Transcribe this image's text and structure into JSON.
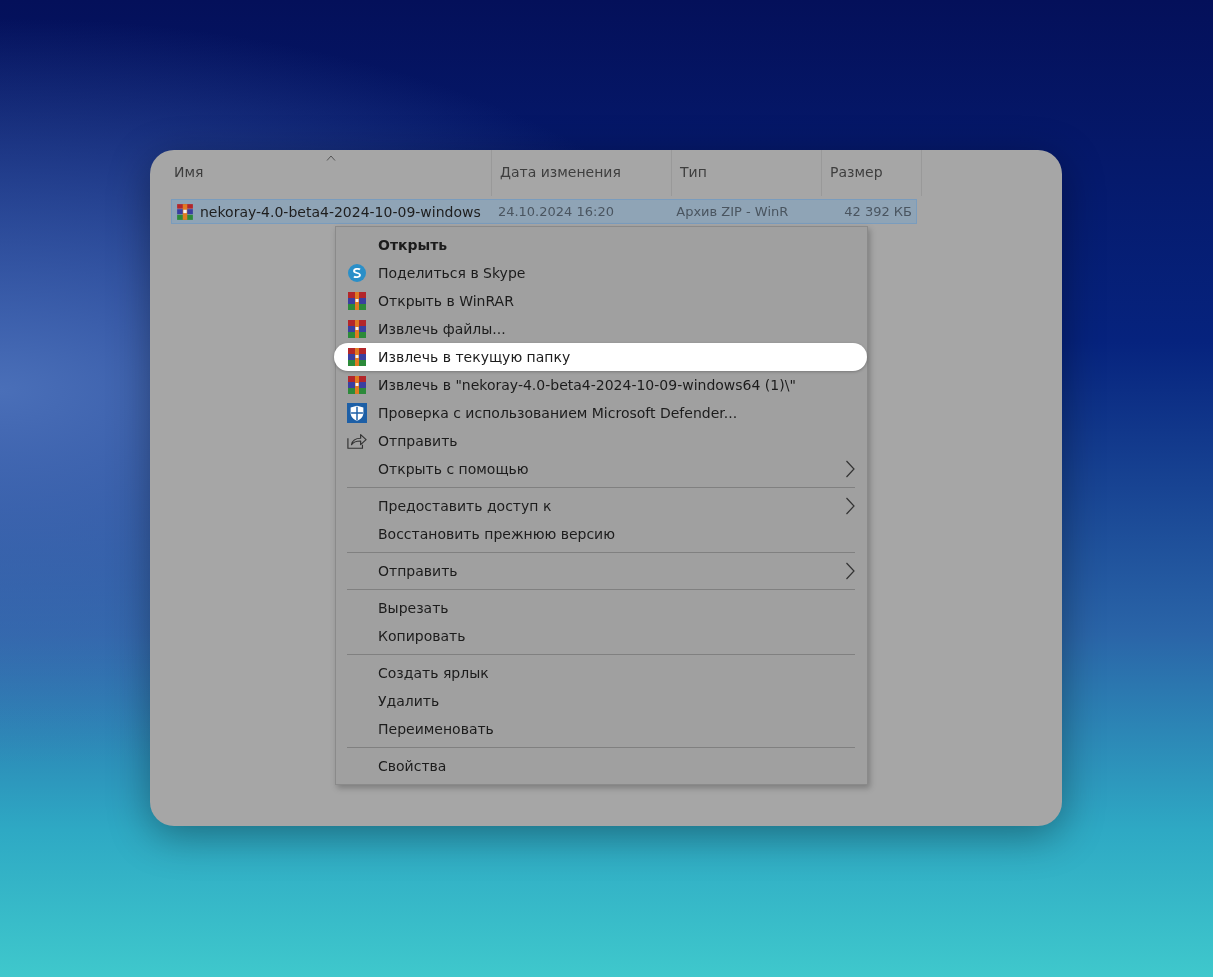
{
  "columns": [
    {
      "label": "Имя",
      "sorted": true
    },
    {
      "label": "Дата изменения",
      "sorted": false
    },
    {
      "label": "Тип",
      "sorted": false
    },
    {
      "label": "Размер",
      "sorted": false
    }
  ],
  "file": {
    "name": "nekoray-4.0-beta4-2024-10-09-windows",
    "date": "24.10.2024 16:20",
    "type": "Архив ZIP - WinR",
    "size": "42 392 КБ",
    "selected": true
  },
  "menu": [
    {
      "kind": "plain",
      "label": "Открыть",
      "default": true,
      "selected": false,
      "submenu": false
    },
    {
      "kind": "skype",
      "label": "Поделиться в Skype",
      "default": false,
      "selected": false,
      "submenu": false
    },
    {
      "kind": "archive",
      "label": "Открыть в WinRAR",
      "default": false,
      "selected": false,
      "submenu": false
    },
    {
      "kind": "archive",
      "label": "Извлечь файлы...",
      "default": false,
      "selected": false,
      "submenu": false
    },
    {
      "kind": "archive",
      "label": "Извлечь в текущую папку",
      "default": false,
      "selected": true,
      "submenu": false
    },
    {
      "kind": "archive",
      "label": "Извлечь в \"nekoray-4.0-beta4-2024-10-09-windows64 (1)\\\"",
      "default": false,
      "selected": false,
      "submenu": false
    },
    {
      "kind": "shield",
      "label": "Проверка с использованием Microsoft Defender...",
      "default": false,
      "selected": false,
      "submenu": false
    },
    {
      "kind": "share",
      "label": "Отправить",
      "default": false,
      "selected": false,
      "submenu": false
    },
    {
      "kind": "plain",
      "label": "Открыть с помощью",
      "default": false,
      "selected": false,
      "submenu": true
    },
    {
      "kind": "separator"
    },
    {
      "kind": "plain",
      "label": "Предоставить доступ к",
      "default": false,
      "selected": false,
      "submenu": true
    },
    {
      "kind": "plain",
      "label": "Восстановить прежнюю версию",
      "default": false,
      "selected": false,
      "submenu": false
    },
    {
      "kind": "separator"
    },
    {
      "kind": "plain",
      "label": "Отправить",
      "default": false,
      "selected": false,
      "submenu": true
    },
    {
      "kind": "separator"
    },
    {
      "kind": "plain",
      "label": "Вырезать",
      "default": false,
      "selected": false,
      "submenu": false
    },
    {
      "kind": "plain",
      "label": "Копировать",
      "default": false,
      "selected": false,
      "submenu": false
    },
    {
      "kind": "separator"
    },
    {
      "kind": "plain",
      "label": "Создать ярлык",
      "default": false,
      "selected": false,
      "submenu": false
    },
    {
      "kind": "plain",
      "label": "Удалить",
      "default": false,
      "selected": false,
      "submenu": false
    },
    {
      "kind": "plain",
      "label": "Переименовать",
      "default": false,
      "selected": false,
      "submenu": false
    },
    {
      "kind": "separator"
    },
    {
      "kind": "plain",
      "label": "Свойства",
      "default": false,
      "selected": false,
      "submenu": false
    }
  ]
}
